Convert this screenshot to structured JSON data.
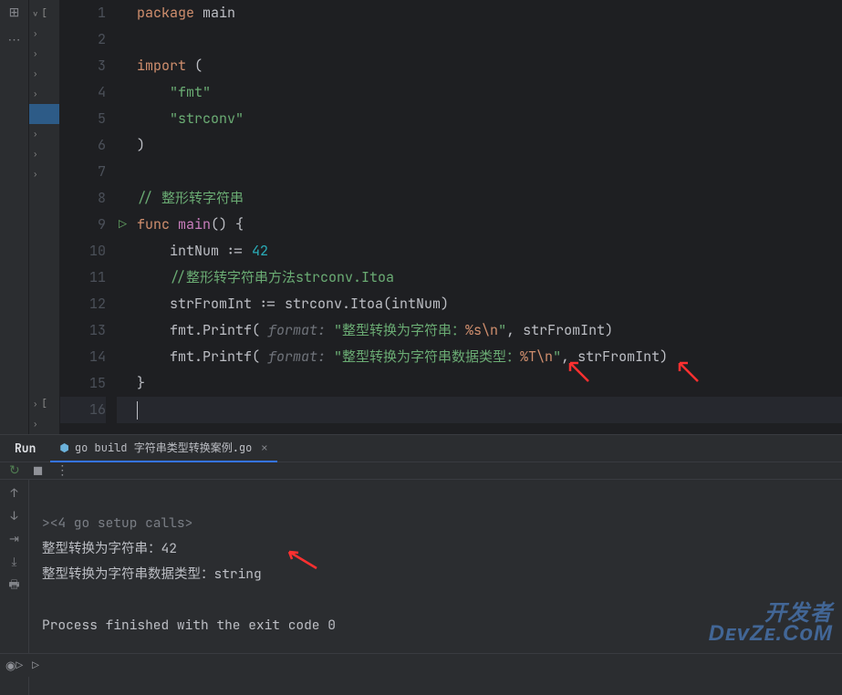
{
  "project": {
    "items": [
      "∨",
      "›",
      "›",
      "›",
      "›",
      "›",
      "›",
      "›",
      "›",
      "›"
    ]
  },
  "code": {
    "l1": {
      "pre": "package ",
      "pkg": "main"
    },
    "l3": {
      "pre": "import ",
      "paren": "("
    },
    "l4": {
      "str": "    \"fmt\""
    },
    "l5": {
      "str": "    \"strconv\""
    },
    "l6": {
      "paren": ")"
    },
    "l8": {
      "cmt": "// 整形转字符串"
    },
    "l9": {
      "kw": "func ",
      "fn": "main",
      "parens": "()",
      "brace": " {"
    },
    "l10": {
      "txt": "    intNum := ",
      "num": "42"
    },
    "l11": {
      "cmt": "    //整形转字符串方法strconv.Itoa"
    },
    "l12": {
      "txt": "    strFromInt := strconv.Itoa(intNum)"
    },
    "l13": {
      "pre": "    fmt.Printf(",
      "hint": " format: ",
      "str1": "\"整型转换为字符串：",
      "esc": "%s\\n",
      "str2": "\"",
      "post": ", strFromInt)"
    },
    "l14": {
      "pre": "    fmt.Printf(",
      "hint": " format: ",
      "str1": "\"整型转换为字符串数据类型：",
      "esc": "%T\\n",
      "str2": "\"",
      "post": ", strFromInt)"
    },
    "l15": {
      "brace": "}"
    }
  },
  "run": {
    "label": "Run",
    "tab": "go build 字符串类型转换案例.go",
    "output": {
      "setup": "<4 go setup calls>",
      "line1": "整型转换为字符串：42",
      "line2": "整型转换为字符串数据类型：string",
      "exit": "Process finished with the exit code 0"
    }
  },
  "watermark": {
    "l1": "开发者",
    "l2": "DᴇᴠZᴇ.CᴏM"
  }
}
